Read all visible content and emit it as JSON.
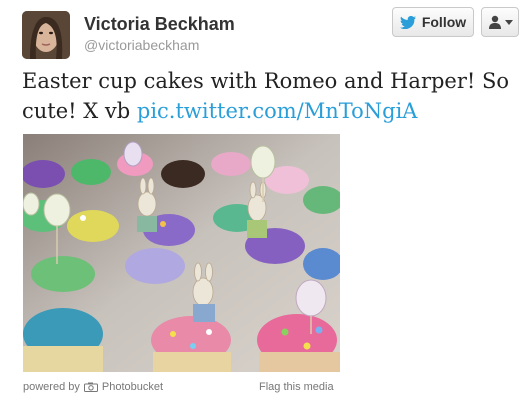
{
  "profile": {
    "name": "Victoria Beckham",
    "handle": "@victoriabeckham"
  },
  "actions": {
    "follow_label": "Follow",
    "user_menu_icon": "person-icon"
  },
  "tweet": {
    "text": "Easter cup cakes with Romeo and Harper! So cute! X vb ",
    "link": "pic.twitter.com/MnToNgiA",
    "link_color": "#2a9ed8"
  },
  "media": {
    "powered_prefix": "powered by",
    "provider": "Photobucket",
    "flag_label": "Flag this media"
  },
  "colors": {
    "follow_bird": "#2a9ed8",
    "name": "#333333",
    "handle": "#999999"
  }
}
